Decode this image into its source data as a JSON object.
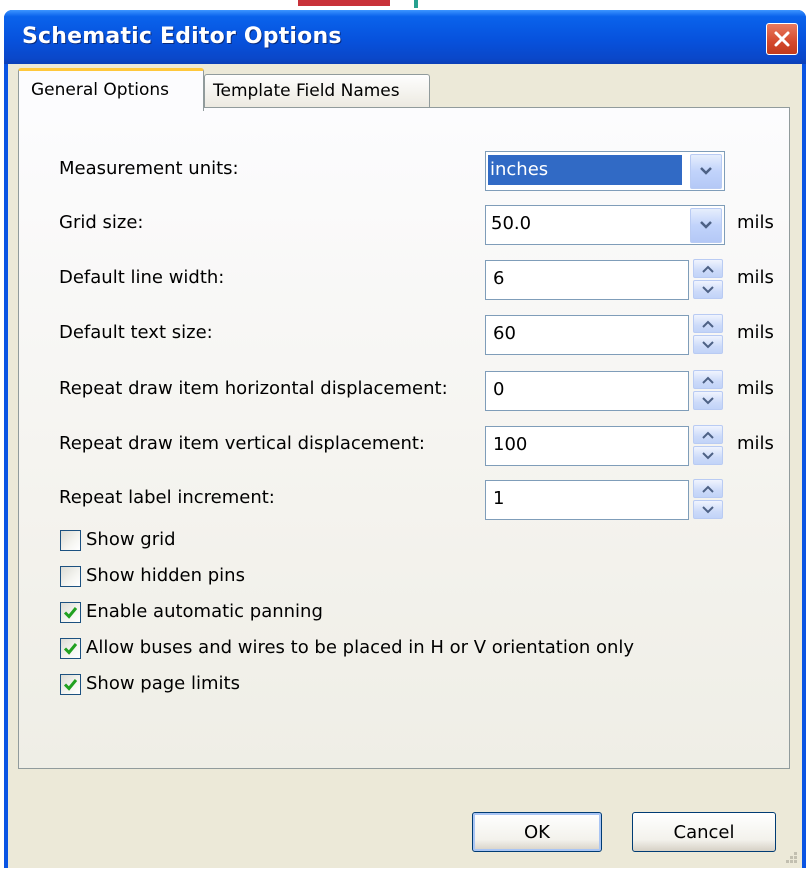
{
  "window": {
    "title": "Schematic Editor Options"
  },
  "tabs": [
    {
      "label": "General Options",
      "active": true
    },
    {
      "label": "Template Field Names",
      "active": false
    }
  ],
  "fields": {
    "measurement_units": {
      "label": "Measurement units:",
      "value": "inches"
    },
    "grid_size": {
      "label": "Grid size:",
      "value": "50.0",
      "unit": "mils"
    },
    "default_line_width": {
      "label": "Default line width:",
      "value": "6",
      "unit": "mils"
    },
    "default_text_size": {
      "label": "Default text size:",
      "value": "60",
      "unit": "mils"
    },
    "repeat_h": {
      "label": "Repeat draw item horizontal displacement:",
      "value": "0",
      "unit": "mils"
    },
    "repeat_v": {
      "label": "Repeat draw item vertical displacement:",
      "value": "100",
      "unit": "mils"
    },
    "repeat_label": {
      "label": "Repeat label increment:",
      "value": "1"
    }
  },
  "checkboxes": [
    {
      "label": "Show grid",
      "checked": false
    },
    {
      "label": "Show hidden pins",
      "checked": false
    },
    {
      "label": "Enable automatic panning",
      "checked": true
    },
    {
      "label": "Allow buses and wires to be placed in H or V orientation only",
      "checked": true
    },
    {
      "label": "Show page limits",
      "checked": true
    }
  ],
  "buttons": {
    "ok": "OK",
    "cancel": "Cancel"
  },
  "colors": {
    "titlebar": "#0a54e3",
    "close_button": "#d4492c",
    "dialog_face": "#ece9d8",
    "selection": "#316ac5",
    "check": "#21a121"
  }
}
